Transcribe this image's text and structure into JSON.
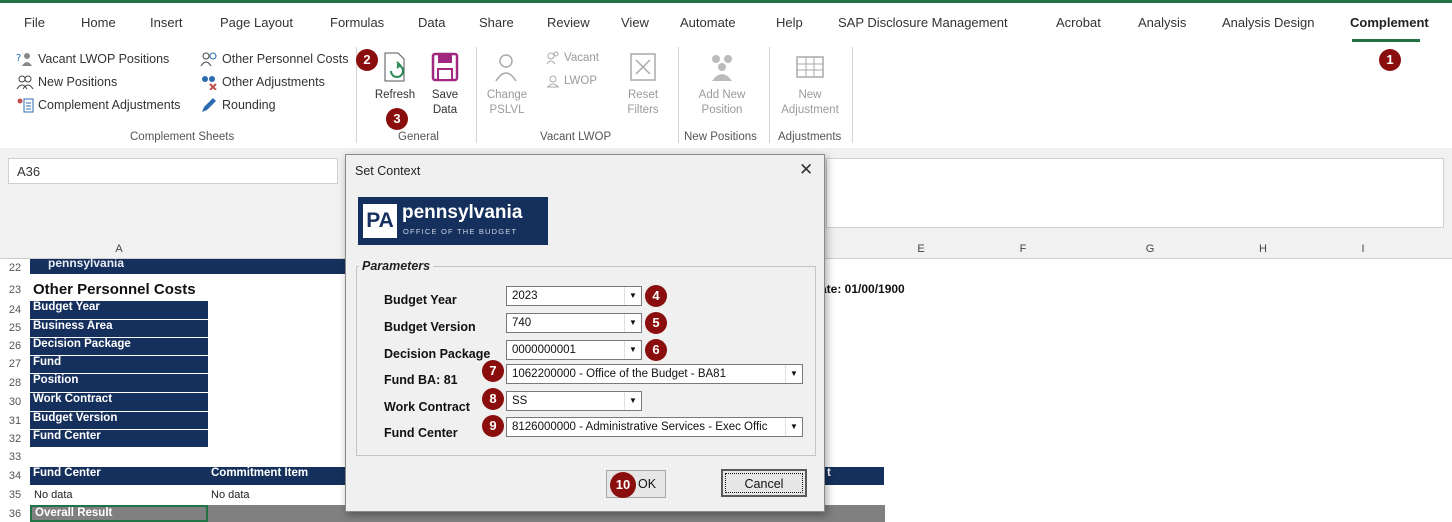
{
  "ribbon_tabs": [
    "File",
    "Home",
    "Insert",
    "Page Layout",
    "Formulas",
    "Data",
    "Share",
    "Review",
    "View",
    "Automate",
    "Help",
    "SAP Disclosure Management",
    "Acrobat",
    "Analysis",
    "Analysis Design",
    "Complement"
  ],
  "complement_sheets": {
    "vacant_lwop": "Vacant LWOP Positions",
    "new_positions": "New Positions",
    "complement_adjustments": "Complement Adjustments",
    "other_personnel_costs": "Other Personnel Costs",
    "other_adjustments": "Other Adjustments",
    "rounding": "Rounding",
    "group_label": "Complement Sheets"
  },
  "general": {
    "refresh": "Refresh",
    "save_line1": "Save",
    "save_line2": "Data",
    "group_label": "General"
  },
  "vacant_lwop_group": {
    "change_line1": "Change",
    "change_line2": "PSLVL",
    "vacant": "Vacant",
    "lwop": "LWOP",
    "reset_line1": "Reset",
    "reset_line2": "Filters",
    "group_label": "Vacant LWOP"
  },
  "new_positions_group": {
    "add_line1": "Add New",
    "add_line2": "Position",
    "group_label": "New Positions"
  },
  "adjustments_group": {
    "new_line1": "New",
    "new_line2": "Adjustment",
    "group_label": "Adjustments"
  },
  "name_box": "A36",
  "columns": [
    "A",
    "E",
    "F",
    "G",
    "H",
    "I"
  ],
  "sheet": {
    "logo_text": "pennsylvania",
    "title": "Other Personnel Costs",
    "labels": [
      "Budget Year",
      "Business Area",
      "Decision Package",
      "Fund",
      "Position",
      "Work Contract",
      "Budget Version",
      "Fund Center"
    ],
    "row_numbers": [
      "22",
      "23",
      "24",
      "25",
      "26",
      "27",
      "28",
      "30",
      "31",
      "32",
      "33",
      "34",
      "35",
      "36"
    ],
    "date_text": "ate: 01/00/1900",
    "col_fund_center": "Fund Center",
    "col_commitment_item": "Commitment Item",
    "col_trailing": "t",
    "no_data_1": "No data",
    "no_data_2": "No data",
    "overall_result": "Overall Result"
  },
  "dialog": {
    "title": "Set Context",
    "logo_name": "pennsylvania",
    "logo_sub": "OFFICE OF THE BUDGET",
    "logo_mark": "PA",
    "legend": "Parameters",
    "fields": [
      {
        "label": "Budget Year",
        "value": "2023"
      },
      {
        "label": "Budget Version",
        "value": "740"
      },
      {
        "label": "Decision Package",
        "value": "0000000001"
      },
      {
        "label": "Fund  BA: 81",
        "value": "1062200000 - Office of the Budget - BA81"
      },
      {
        "label": "Work Contract",
        "value": "SS"
      },
      {
        "label": "Fund Center",
        "value": "8126000000 - Administrative Services - Exec Offic"
      }
    ],
    "ok": "OK",
    "cancel": "Cancel"
  },
  "callouts": [
    "1",
    "2",
    "3",
    "4",
    "5",
    "6",
    "7",
    "8",
    "9",
    "10"
  ],
  "colors": {
    "excel_green": "#217346",
    "navy": "#15305c",
    "badge": "#8b0e0e"
  }
}
